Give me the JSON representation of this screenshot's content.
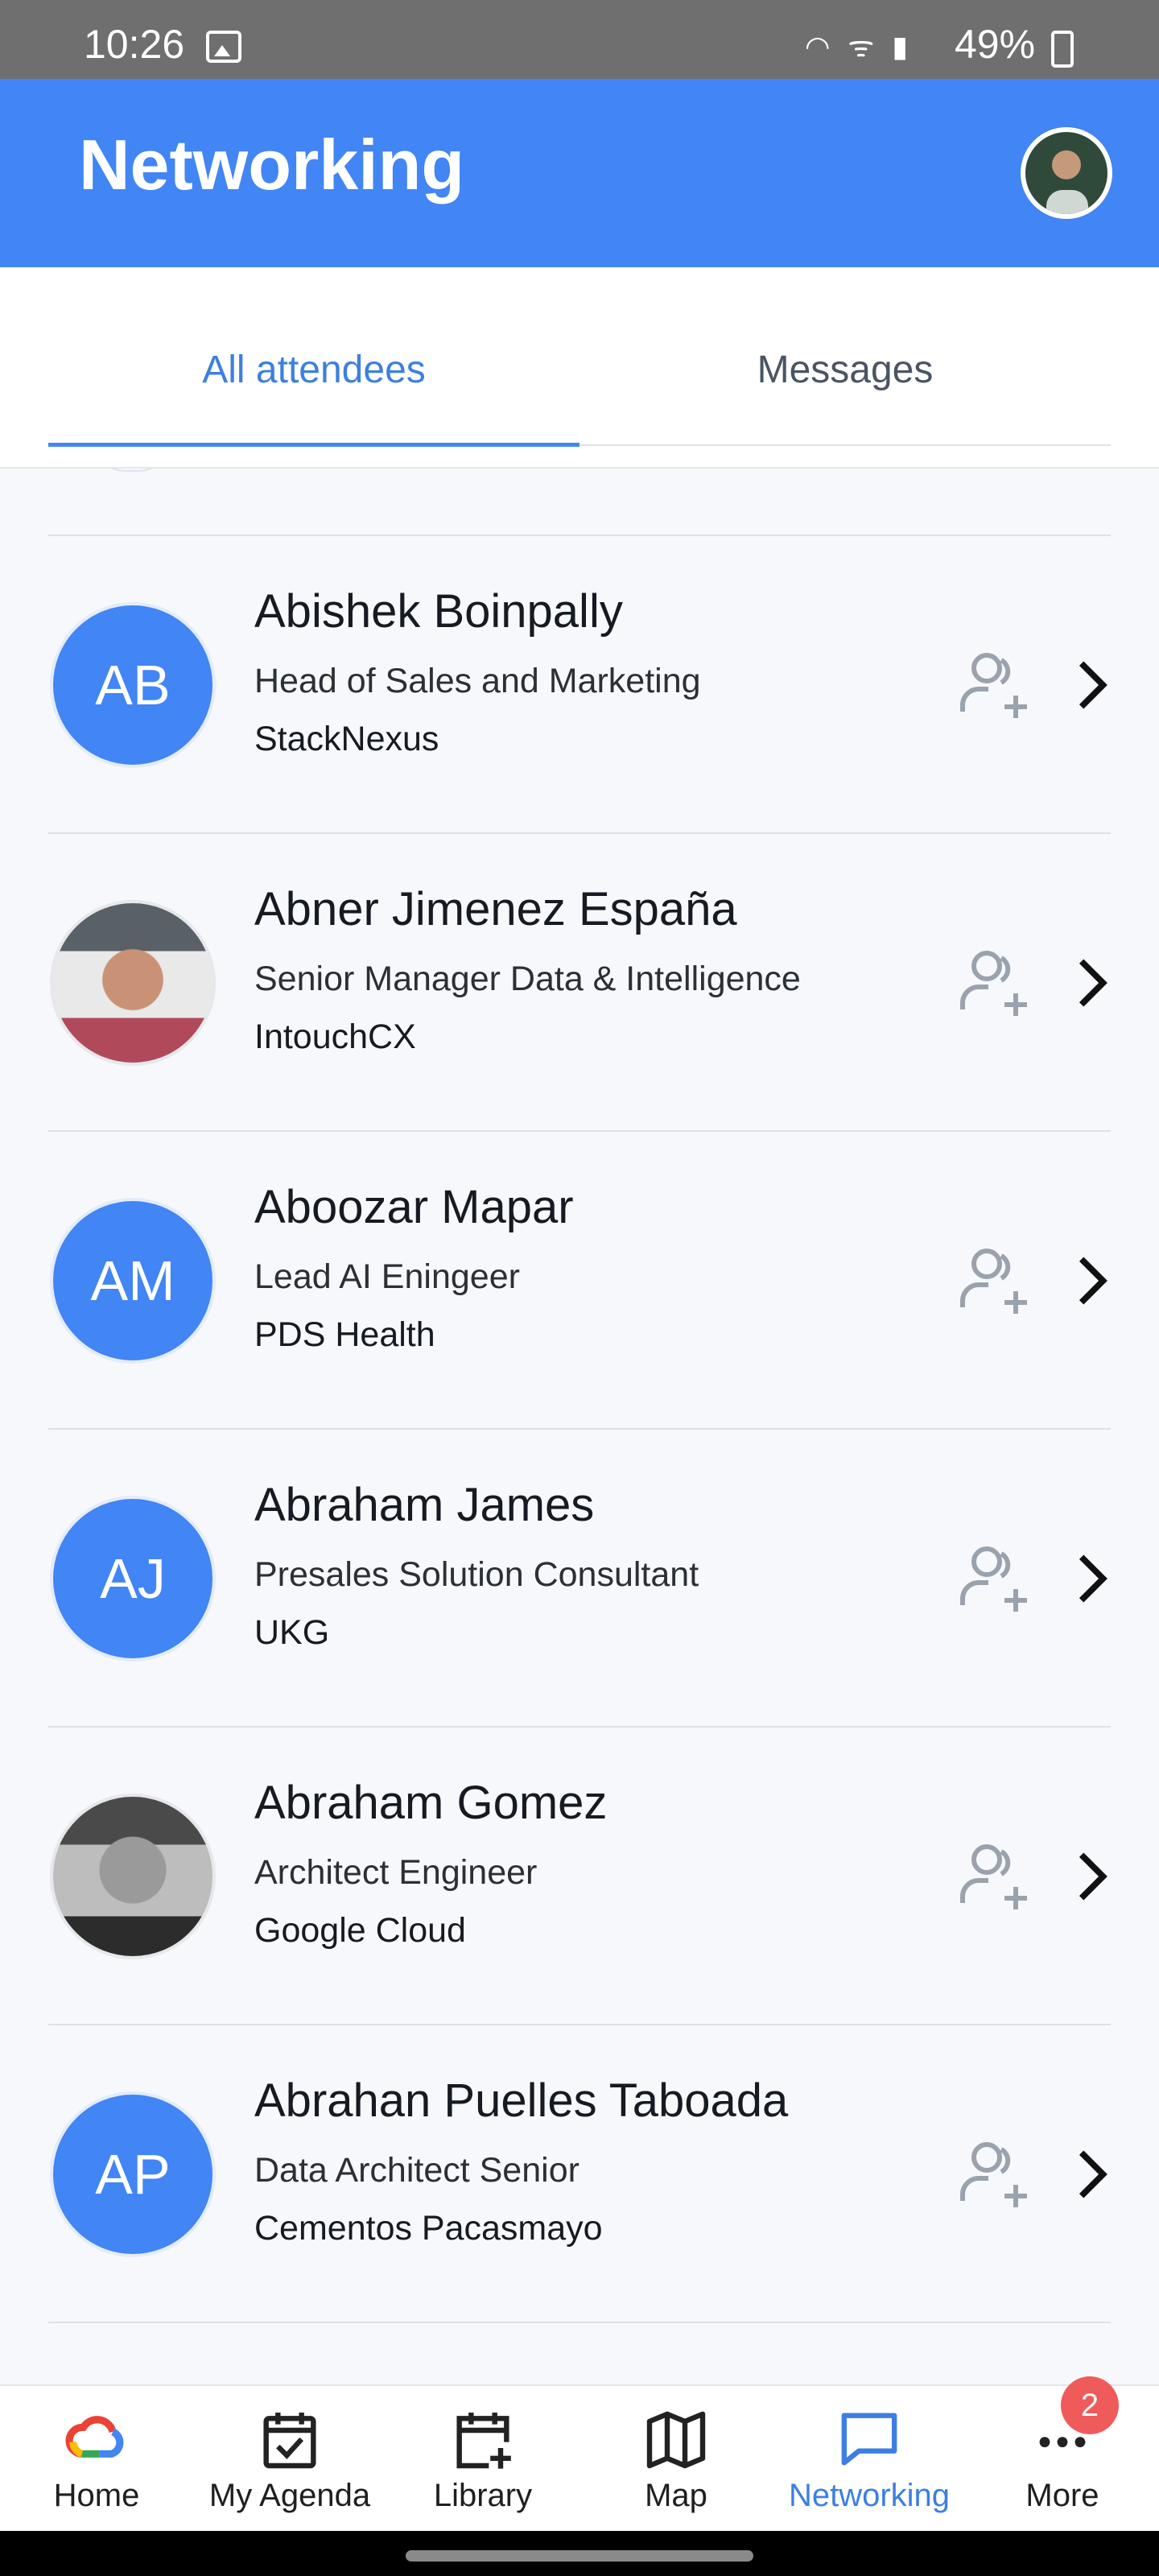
{
  "status_bar": {
    "time": "10:26",
    "battery": "49%",
    "icons": "◠ ᯤ ▮"
  },
  "header": {
    "title": "Networking",
    "avatar_icon": "profile-photo"
  },
  "tabs": [
    {
      "label": "All attendees",
      "active": true
    },
    {
      "label": "Messages",
      "active": false
    }
  ],
  "attendees": [
    {
      "initials": "AB",
      "name": "Abishek Boinpally",
      "role": "Head of Sales and Marketing",
      "company": "StackNexus"
    },
    {
      "initials": "",
      "photo": true,
      "name": "Abner Jimenez España",
      "role": "Senior Manager Data & Intelligence",
      "company": "IntouchCX"
    },
    {
      "initials": "AM",
      "name": "Aboozar Mapar",
      "role": "Lead AI Eningeer",
      "company": "PDS Health"
    },
    {
      "initials": "AJ",
      "name": "Abraham James",
      "role": "Presales Solution Consultant",
      "company": "UKG"
    },
    {
      "initials": "",
      "photo": true,
      "name": "Abraham Gomez",
      "role": "Architect Engineer",
      "company": "Google Cloud"
    },
    {
      "initials": "AP",
      "name": "Abrahan Puelles Taboada",
      "role": "Data Architect Senior",
      "company": "Cementos Pacasmayo"
    }
  ],
  "bottom_nav": [
    {
      "label": "Home",
      "icon": "google-cloud-icon"
    },
    {
      "label": "My Agenda",
      "icon": "calendar-check-icon"
    },
    {
      "label": "Library",
      "icon": "calendar-add-icon"
    },
    {
      "label": "Map",
      "icon": "map-icon"
    },
    {
      "label": "Networking",
      "icon": "chat-icon",
      "active": true
    },
    {
      "label": "More",
      "icon": "more-icon",
      "badge": "2"
    }
  ],
  "colors": {
    "primary": "#4285f4",
    "badge": "#ef5b5b",
    "icon_gray": "#9aa3ad"
  }
}
